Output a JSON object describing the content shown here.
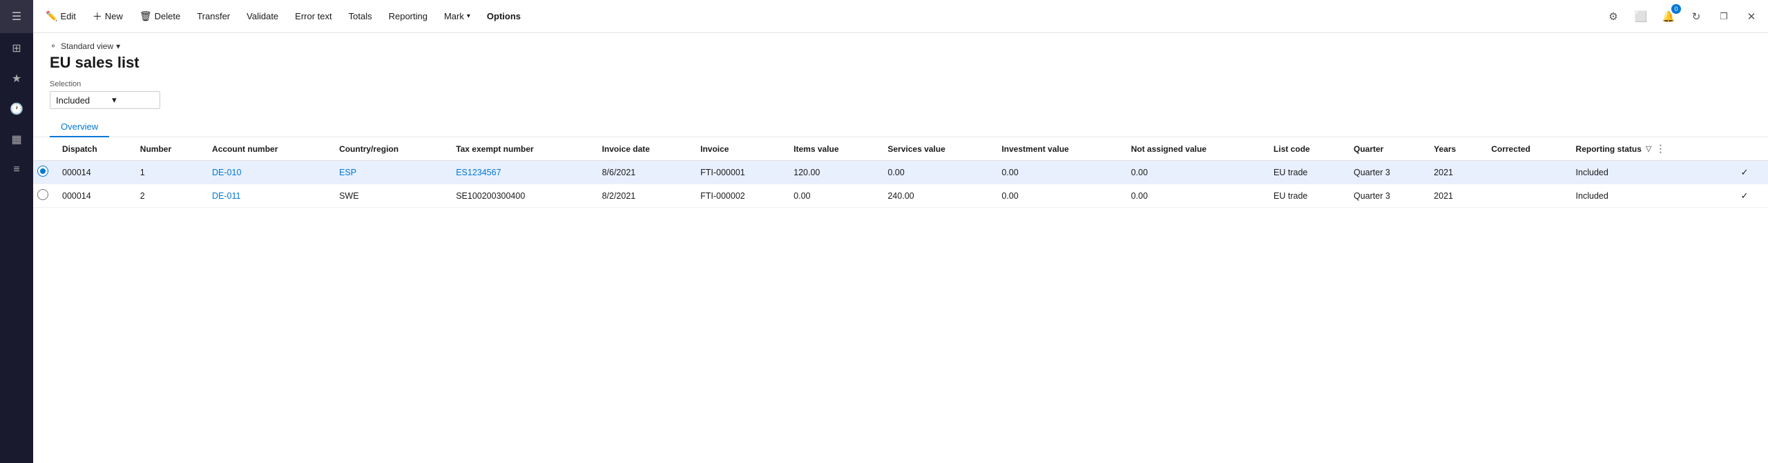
{
  "sidebar": {
    "icons": [
      {
        "name": "hamburger-icon",
        "symbol": "☰"
      },
      {
        "name": "home-icon",
        "symbol": "⊞"
      },
      {
        "name": "star-icon",
        "symbol": "★"
      },
      {
        "name": "recent-icon",
        "symbol": "🕐"
      },
      {
        "name": "grid-icon",
        "symbol": "▦"
      },
      {
        "name": "list-icon",
        "symbol": "≡"
      }
    ]
  },
  "toolbar": {
    "edit_label": "Edit",
    "new_label": "New",
    "delete_label": "Delete",
    "transfer_label": "Transfer",
    "validate_label": "Validate",
    "error_text_label": "Error text",
    "totals_label": "Totals",
    "reporting_label": "Reporting",
    "mark_label": "Mark",
    "options_label": "Options",
    "right_icons": [
      {
        "name": "settings-icon",
        "symbol": "⚙"
      },
      {
        "name": "panel-icon",
        "symbol": "⬜"
      },
      {
        "name": "notification-icon",
        "symbol": "🔔",
        "badge": "0"
      },
      {
        "name": "refresh-icon",
        "symbol": "↻"
      },
      {
        "name": "restore-icon",
        "symbol": "❐"
      },
      {
        "name": "close-icon",
        "symbol": "✕"
      }
    ]
  },
  "page": {
    "filter_label": "Standard view",
    "title": "EU sales list",
    "selection_label": "Selection",
    "selection_value": "Included",
    "tabs": [
      {
        "label": "Overview",
        "active": true
      }
    ]
  },
  "table": {
    "columns": [
      {
        "key": "check",
        "label": ""
      },
      {
        "key": "dispatch",
        "label": "Dispatch"
      },
      {
        "key": "number",
        "label": "Number"
      },
      {
        "key": "account_number",
        "label": "Account number"
      },
      {
        "key": "country_region",
        "label": "Country/region"
      },
      {
        "key": "tax_exempt_number",
        "label": "Tax exempt number"
      },
      {
        "key": "invoice_date",
        "label": "Invoice date"
      },
      {
        "key": "invoice",
        "label": "Invoice"
      },
      {
        "key": "items_value",
        "label": "Items value"
      },
      {
        "key": "services_value",
        "label": "Services value"
      },
      {
        "key": "investment_value",
        "label": "Investment value"
      },
      {
        "key": "not_assigned_value",
        "label": "Not assigned value"
      },
      {
        "key": "list_code",
        "label": "List code"
      },
      {
        "key": "quarter",
        "label": "Quarter"
      },
      {
        "key": "years",
        "label": "Years"
      },
      {
        "key": "corrected",
        "label": "Corrected"
      },
      {
        "key": "reporting_status",
        "label": "Reporting status"
      },
      {
        "key": "actions",
        "label": ""
      }
    ],
    "rows": [
      {
        "selected": true,
        "dispatch": "000014",
        "number": "1",
        "account_number": "DE-010",
        "country_region": "ESP",
        "tax_exempt_number": "ES1234567",
        "invoice_date": "8/6/2021",
        "invoice": "FTI-000001",
        "items_value": "120.00",
        "services_value": "0.00",
        "investment_value": "0.00",
        "not_assigned_value": "0.00",
        "list_code": "EU trade",
        "quarter": "Quarter 3",
        "years": "2021",
        "corrected": "",
        "reporting_status": "Included",
        "has_check": true
      },
      {
        "selected": false,
        "dispatch": "000014",
        "number": "2",
        "account_number": "DE-011",
        "country_region": "SWE",
        "tax_exempt_number": "SE100200300400",
        "invoice_date": "8/2/2021",
        "invoice": "FTI-000002",
        "items_value": "0.00",
        "services_value": "240.00",
        "investment_value": "0.00",
        "not_assigned_value": "0.00",
        "list_code": "EU trade",
        "quarter": "Quarter 3",
        "years": "2021",
        "corrected": "",
        "reporting_status": "Included",
        "has_check": true
      }
    ]
  }
}
